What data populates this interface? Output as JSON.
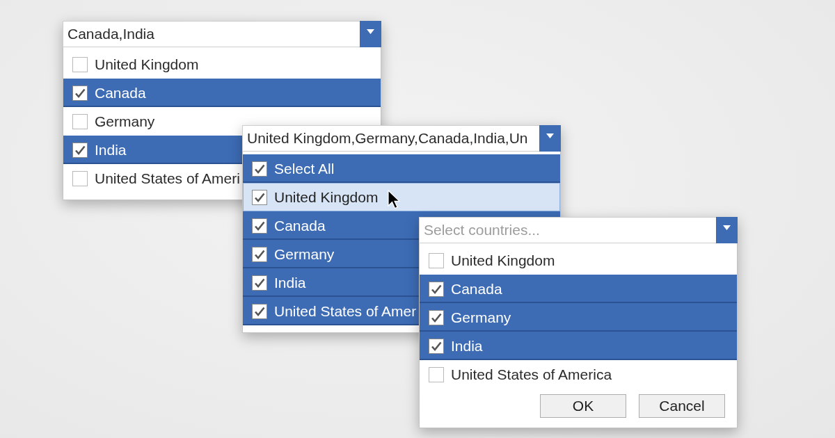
{
  "comboboxes": [
    {
      "value": "Canada,India",
      "items": [
        {
          "label": "United Kingdom",
          "checked": false,
          "selected": false,
          "hovered": false
        },
        {
          "label": "Canada",
          "checked": true,
          "selected": true,
          "hovered": false
        },
        {
          "label": "Germany",
          "checked": false,
          "selected": false,
          "hovered": false
        },
        {
          "label": "India",
          "checked": true,
          "selected": true,
          "hovered": false
        },
        {
          "label": "United States of Ameri",
          "checked": false,
          "selected": false,
          "hovered": false
        }
      ]
    },
    {
      "value": "United Kingdom,Germany,Canada,India,Un",
      "items": [
        {
          "label": "Select All",
          "checked": true,
          "selected": true,
          "hovered": false
        },
        {
          "label": "United Kingdom",
          "checked": true,
          "selected": false,
          "hovered": true
        },
        {
          "label": "Canada",
          "checked": true,
          "selected": true,
          "hovered": false
        },
        {
          "label": "Germany",
          "checked": true,
          "selected": true,
          "hovered": false
        },
        {
          "label": "India",
          "checked": true,
          "selected": true,
          "hovered": false
        },
        {
          "label": "United States of Amer",
          "checked": true,
          "selected": true,
          "hovered": false
        }
      ]
    },
    {
      "placeholder": "Select countries...",
      "items": [
        {
          "label": "United Kingdom",
          "checked": false,
          "selected": false,
          "hovered": false
        },
        {
          "label": "Canada",
          "checked": true,
          "selected": true,
          "hovered": false
        },
        {
          "label": "Germany",
          "checked": true,
          "selected": true,
          "hovered": false
        },
        {
          "label": "India",
          "checked": true,
          "selected": true,
          "hovered": false
        },
        {
          "label": "United States of America",
          "checked": false,
          "selected": false,
          "hovered": false
        }
      ],
      "buttons": [
        "OK",
        "Cancel"
      ]
    }
  ]
}
